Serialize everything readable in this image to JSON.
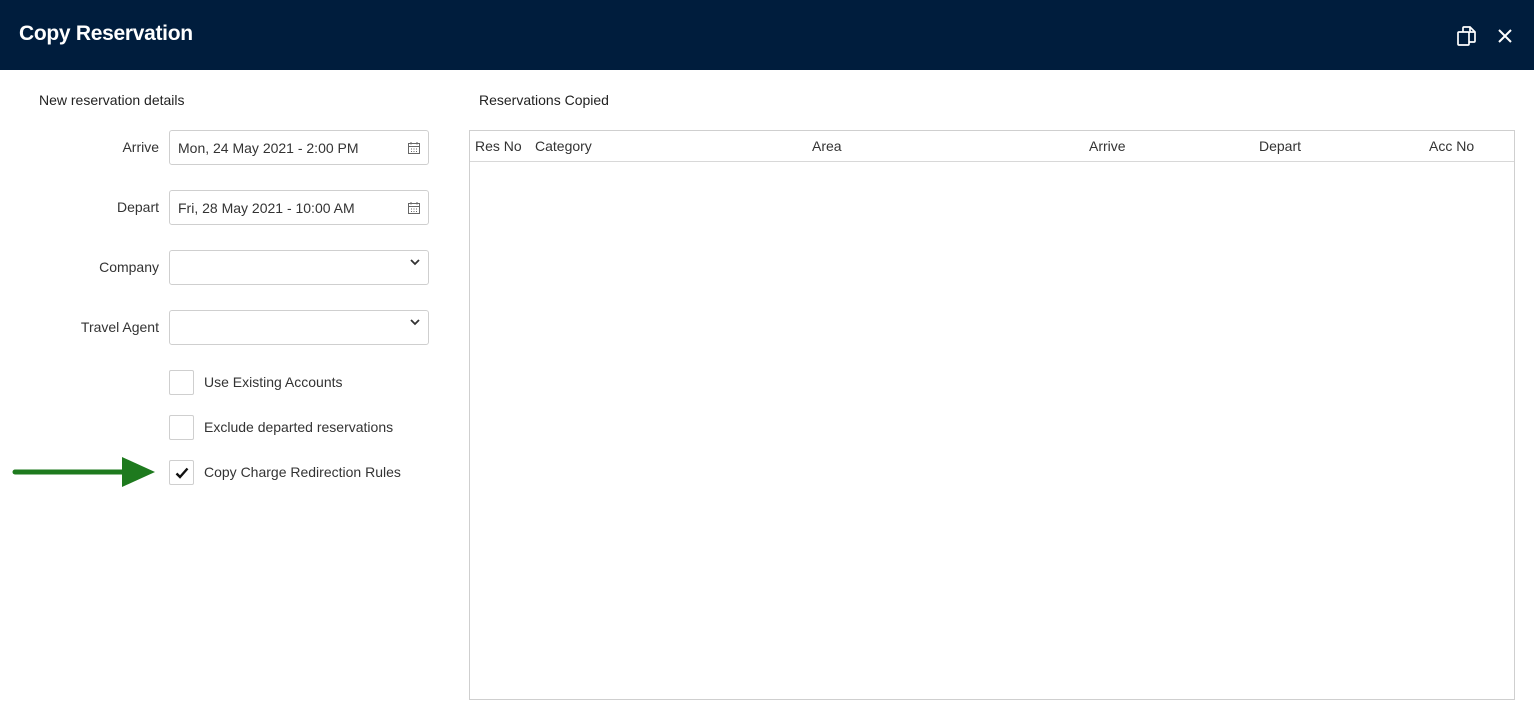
{
  "dialog": {
    "title": "Copy Reservation",
    "icons": {
      "popout": "popout-icon",
      "close": "close-icon"
    }
  },
  "left_panel": {
    "title": "New reservation details",
    "arrive": {
      "label": "Arrive",
      "value": "Mon, 24 May 2021 - 2:00 PM"
    },
    "depart": {
      "label": "Depart",
      "value": "Fri, 28 May 2021 - 10:00 AM"
    },
    "company": {
      "label": "Company",
      "value": ""
    },
    "travel_agent": {
      "label": "Travel Agent",
      "value": ""
    },
    "checkboxes": [
      {
        "label": "Use Existing Accounts",
        "checked": false
      },
      {
        "label": "Exclude departed reservations",
        "checked": false
      },
      {
        "label": "Copy Charge Redirection Rules",
        "checked": true
      }
    ]
  },
  "right_panel": {
    "title": "Reservations Copied",
    "columns": [
      "Res No",
      "Category",
      "Area",
      "Arrive",
      "Depart",
      "Acc No"
    ],
    "rows": []
  },
  "annotation": {
    "arrow_color": "#1e7a1e"
  },
  "colors": {
    "header_bg": "#001d3d",
    "header_text": "#ffffff"
  }
}
